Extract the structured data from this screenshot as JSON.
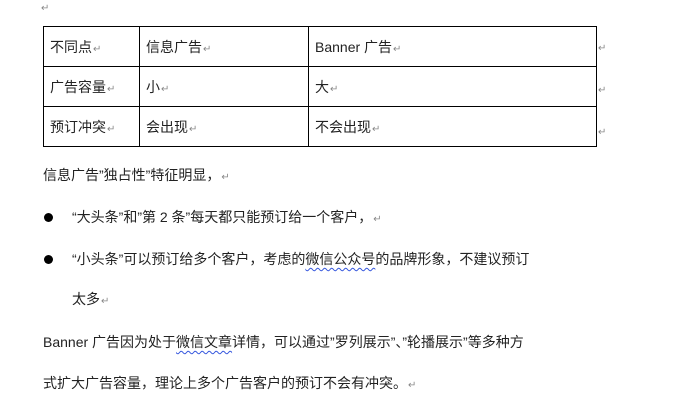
{
  "table": {
    "rows": [
      [
        "不同点",
        "信息广告",
        "Banner 广告"
      ],
      [
        "广告容量",
        "小",
        "大"
      ],
      [
        "预订冲突",
        "会出现",
        "不会出现"
      ]
    ]
  },
  "para1": "信息广告”独占性”特征明显，",
  "bullets": [
    {
      "text": "“大头条”和”第 2 条”每天都只能预订给一个客户，"
    },
    {
      "pre": "“小头条”可以预订给多个客户，考虑的",
      "underlined": "微信公众号",
      "post": "的品牌形象，不建议预订",
      "cont": "太多"
    }
  ],
  "para2": {
    "pre": "Banner 广告因为处于",
    "underlined": "微信文章",
    "post": "详情，可以通过”罗列展示”、”轮播展示”等多种方",
    "line2": "式扩大广告容量，理论上多个广告客户的预订不会有冲突。"
  },
  "return_mark": "↵"
}
